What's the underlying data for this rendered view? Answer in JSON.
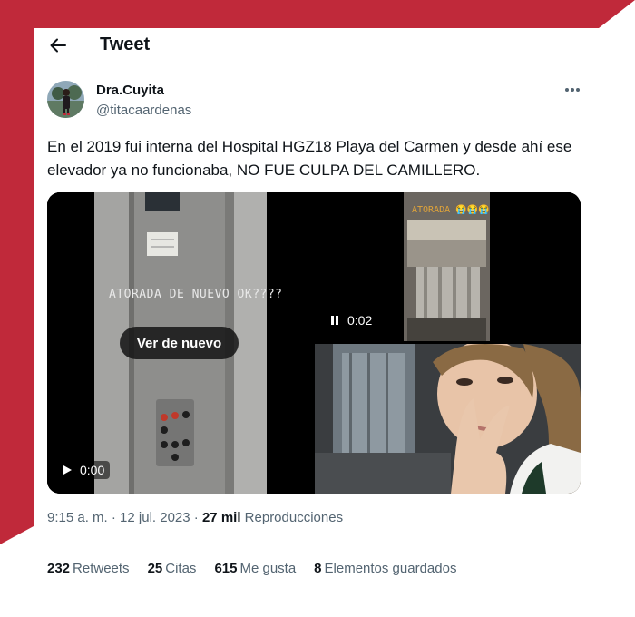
{
  "colors": {
    "frame_red": "#c0293a",
    "text_primary": "#0f1419",
    "text_secondary": "#536471"
  },
  "header": {
    "title": "Tweet",
    "back_icon": "arrow-left-icon"
  },
  "author": {
    "display_name": "Dra.Cuyita",
    "handle": "@titacaardenas",
    "more_icon": "more-horizontal-icon"
  },
  "tweet": {
    "text": "En el 2019 fui interna del Hospital HGZ18 Playa del Carmen y desde ahí ese elevador ya no funcionaba, NO FUE CULPA DEL CAMILLERO."
  },
  "media": {
    "video1": {
      "overlay_text": "ATORADA DE NUEVO OK????",
      "replay_label": "Ver de nuevo",
      "time": "0:00",
      "control_icon": "play-icon"
    },
    "video2": {
      "overlay_text": "ATORADA 😭😭😭",
      "time": "0:02",
      "control_icon": "pause-icon"
    },
    "photo": {
      "icon": "selfie-photo"
    }
  },
  "meta": {
    "time": "9:15 a. m.",
    "separator": "·",
    "date": "12 jul. 2023",
    "views_count": "27 mil",
    "views_label": "Reproducciones"
  },
  "stats": {
    "retweets_count": "232",
    "retweets_label": "Retweets",
    "quotes_count": "25",
    "quotes_label": "Citas",
    "likes_count": "615",
    "likes_label": "Me gusta",
    "bookmarks_count": "8",
    "bookmarks_label": "Elementos guardados"
  }
}
